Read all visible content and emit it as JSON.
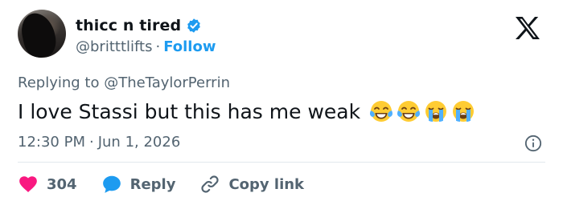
{
  "author": {
    "display_name": "thicc n tired",
    "handle": "@britttlifts",
    "separator": "·",
    "follow_label": "Follow"
  },
  "reply_context": {
    "prefix": "Replying to ",
    "mention": "@TheTaylorPerrin"
  },
  "tweet": {
    "text": "I love Stassi but this has me weak",
    "emojis": [
      "face-with-tears-of-joy-icon",
      "face-with-tears-of-joy-icon",
      "loudly-crying-face-icon",
      "loudly-crying-face-icon"
    ]
  },
  "meta": {
    "time": "12:30 PM",
    "separator": "·",
    "date": "Jun 1, 2026"
  },
  "actions": {
    "likes_count": "304",
    "reply_label": "Reply",
    "copy_label": "Copy link"
  },
  "colors": {
    "accent": "#1d9bf0",
    "like": "#f91880",
    "muted": "#536471",
    "text": "#0f1419"
  }
}
